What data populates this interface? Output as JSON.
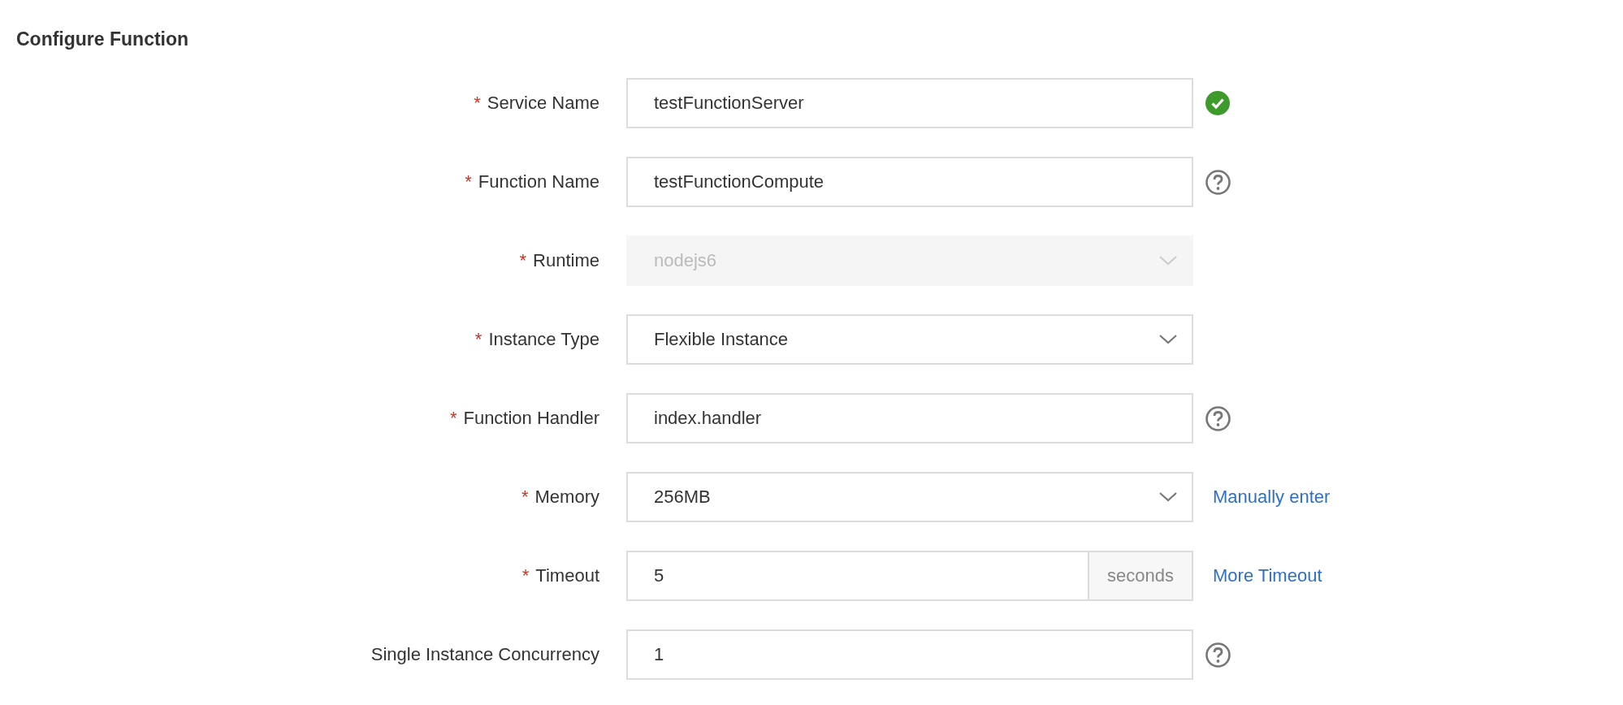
{
  "title": "Configure Function",
  "fields": [
    {
      "label": "Service Name",
      "required_mark": "*",
      "kind": "text",
      "value": "testFunctionServer",
      "disabled": false,
      "aside": {
        "kind": "valid"
      }
    },
    {
      "label": "Function Name",
      "required_mark": "*",
      "kind": "text",
      "value": "testFunctionCompute",
      "disabled": false,
      "aside": {
        "kind": "help"
      }
    },
    {
      "label": "Runtime",
      "required_mark": "*",
      "kind": "select",
      "value": "nodejs6",
      "disabled": true
    },
    {
      "label": "Instance Type",
      "required_mark": "*",
      "kind": "select",
      "value": "Flexible Instance",
      "disabled": false
    },
    {
      "label": "Function Handler",
      "required_mark": "*",
      "kind": "text",
      "value": "index.handler",
      "disabled": false,
      "aside": {
        "kind": "help"
      }
    },
    {
      "label": "Memory",
      "required_mark": "*",
      "kind": "select",
      "value": "256MB",
      "disabled": false,
      "aside": {
        "kind": "link",
        "text": "Manually enter"
      }
    },
    {
      "label": "Timeout",
      "required_mark": "*",
      "kind": "unit",
      "value": "5",
      "unit": "seconds",
      "disabled": false,
      "aside": {
        "kind": "link",
        "text": "More Timeout"
      }
    },
    {
      "label": "Single Instance Concurrency",
      "kind": "text",
      "value": "1",
      "disabled": false,
      "aside": {
        "kind": "help"
      }
    }
  ]
}
